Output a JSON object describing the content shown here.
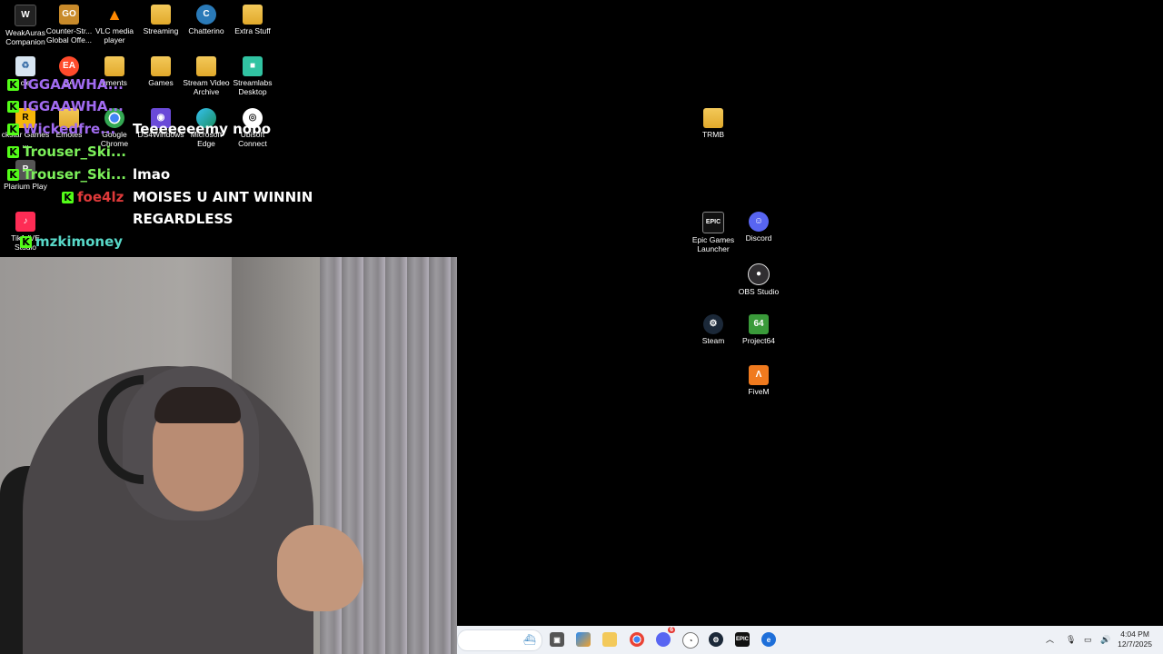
{
  "desktop_icons": {
    "weakauras": "WeakAuras Companion",
    "counterstrike": "Counter-Str... Global Offe...",
    "vlc": "VLC media player",
    "streaming": "Streaming",
    "chatterino": "Chatterino",
    "extrastuff": "Extra Stuff",
    "recycle": "cle",
    "ea": "EA",
    "documents": "uments",
    "games": "Games",
    "streamvideo": "Stream Video Archive",
    "streamlabs": "Streamlabs Desktop",
    "rockstar": "ckstar Games ...",
    "emotes": "Emotes",
    "chrome": "Google Chrome",
    "ds4": "DS4Windows",
    "edge": "Microsoft Edge",
    "ubisoft": "Ubisoft Connect",
    "plarium": "Plarium Play",
    "tiktok": "Tik1 IVE Studio",
    "trmb": "TRMB",
    "epic": "Epic Games Launcher",
    "discord": "Discord",
    "obs": "OBS Studio",
    "steam": "Steam",
    "project64": "Project64",
    "fivem": "FiveM"
  },
  "chat": {
    "badge": "K",
    "lines": [
      {
        "user": "IGGAAWHA...",
        "color": "#a16bf0",
        "message": ""
      },
      {
        "user": "IGGAAWHA...",
        "color": "#a16bf0",
        "message": ""
      },
      {
        "user": "Wickedfre...",
        "color": "#a16bf0",
        "message": "Teeeeeeemy nobo"
      },
      {
        "user": "Trouser_Ski...",
        "color": "#7cf05a",
        "message": ""
      },
      {
        "user": "Trouser_Ski...",
        "color": "#7cf05a",
        "message": "lmao"
      },
      {
        "user": "foe4lz",
        "color": "#e03a3a",
        "message": "MOISES U AINT WINNIN"
      },
      {
        "user": "",
        "color": "#ffffff",
        "message": "REGARDLESS"
      },
      {
        "user": "mzkimoney",
        "color": "#58d8c8",
        "message": ""
      }
    ]
  },
  "taskbar": {
    "apps": [
      "file-explorer",
      "copilot",
      "folder",
      "chrome",
      "discord",
      "clock-app",
      "steam",
      "epic-games",
      "edge-dev"
    ],
    "discord_badge": "6",
    "time": "4:04 PM",
    "date": "12/7/2025",
    "colors": {
      "taskbar_bg": "#eef1f6",
      "chrome": "#4285f4",
      "discord": "#5865f2",
      "steam": "#1b2838"
    }
  }
}
